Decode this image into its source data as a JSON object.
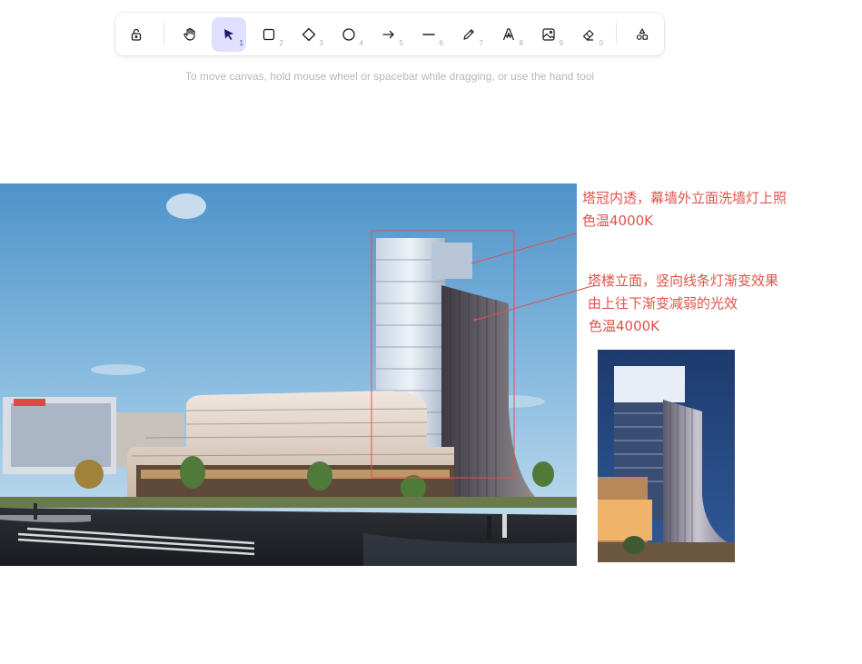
{
  "toolbar": {
    "tools": [
      {
        "name": "lock",
        "key": ""
      },
      {
        "name": "hand",
        "key": ""
      },
      {
        "name": "selection",
        "key": "1"
      },
      {
        "name": "rectangle",
        "key": "2"
      },
      {
        "name": "diamond",
        "key": "3"
      },
      {
        "name": "ellipse",
        "key": "4"
      },
      {
        "name": "arrow",
        "key": "5"
      },
      {
        "name": "line",
        "key": "6"
      },
      {
        "name": "draw",
        "key": "7"
      },
      {
        "name": "text",
        "key": "8"
      },
      {
        "name": "image",
        "key": "9"
      },
      {
        "name": "eraser",
        "key": "0"
      },
      {
        "name": "more-shapes",
        "key": ""
      }
    ],
    "active_tool": "selection"
  },
  "hint": "To move canvas, hold mouse wheel or spacebar while dragging, or use the hand tool",
  "annotations": {
    "crown_line1": "塔冠内透，幕墙外立面洗墙灯上照",
    "crown_line2": "色温4000K",
    "facade_line1": "塔楼立面，竖向线条灯渐变效果",
    "facade_line2": "由上往下渐变减弱的光效",
    "facade_line3": "色温4000K"
  },
  "colors": {
    "annotation": "#e0524a",
    "active_tool_bg": "#e0dfff",
    "active_tool_icon": "#1e1b6b"
  }
}
